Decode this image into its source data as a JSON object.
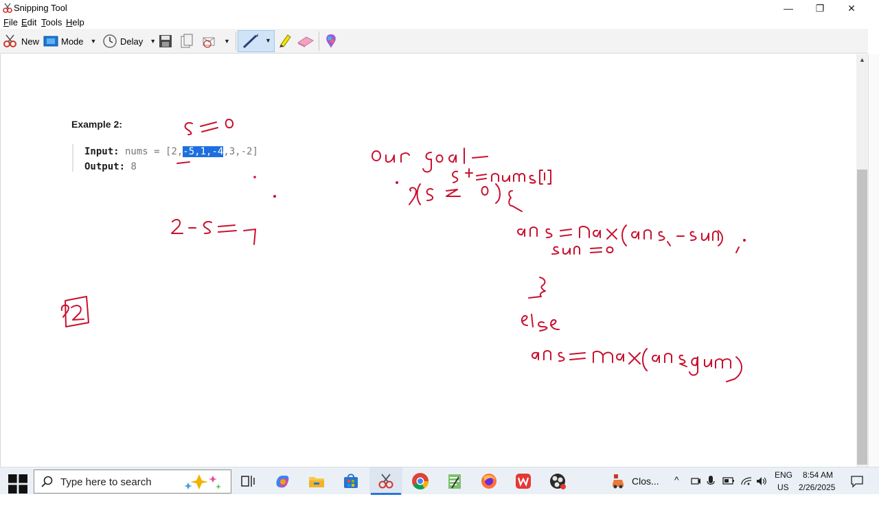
{
  "window": {
    "title": "Snipping Tool",
    "controls": {
      "minimize": "—",
      "restore": "❐",
      "close": "✕"
    }
  },
  "menu": {
    "file_pre": "",
    "file_u": "F",
    "file_post": "ile",
    "edit_pre": "",
    "edit_u": "E",
    "edit_post": "dit",
    "tools_pre": "",
    "tools_u": "T",
    "tools_post": "ools",
    "help_pre": "",
    "help_u": "H",
    "help_post": "elp"
  },
  "toolbar": {
    "new_label": "New",
    "mode_label": "Mode",
    "delay_label": "Delay",
    "dropdown_glyph": "▼"
  },
  "content": {
    "example_title": "Example 2:",
    "input_label": "Input:",
    "input_var": " nums = [2,",
    "input_selected": "-5,1,-4",
    "input_rest": ",3,-2]",
    "output_label": "Output:",
    "output_value": " 8"
  },
  "scrollbar": {
    "up_arrow": "▲"
  },
  "taskbar": {
    "search_placeholder": "Type here to search",
    "pinned_label": "Clos...",
    "lang_top": "ENG",
    "lang_bottom": "US",
    "time": "8:54 AM",
    "date": "2/26/2025",
    "tray_chevron": "^"
  },
  "colors": {
    "ink": "#c8102e",
    "selection": "#1d6fe0",
    "pen_highlight": "#cfe4f7",
    "taskbar_bg": "#eaf0f6"
  },
  "icons": [
    "snipping-tool-icon",
    "new-snip-icon",
    "mode-icon",
    "delay-clock-icon",
    "save-icon",
    "copy-icon",
    "send-icon",
    "pen-icon",
    "highlighter-icon",
    "eraser-icon",
    "paint3d-icon",
    "windows-start-icon",
    "search-icon",
    "task-view-icon",
    "copilot-icon",
    "file-explorer-icon",
    "store-icon",
    "chrome-icon",
    "notepad-icon",
    "firefox-icon",
    "wps-icon",
    "obs-icon",
    "notification-icon"
  ]
}
